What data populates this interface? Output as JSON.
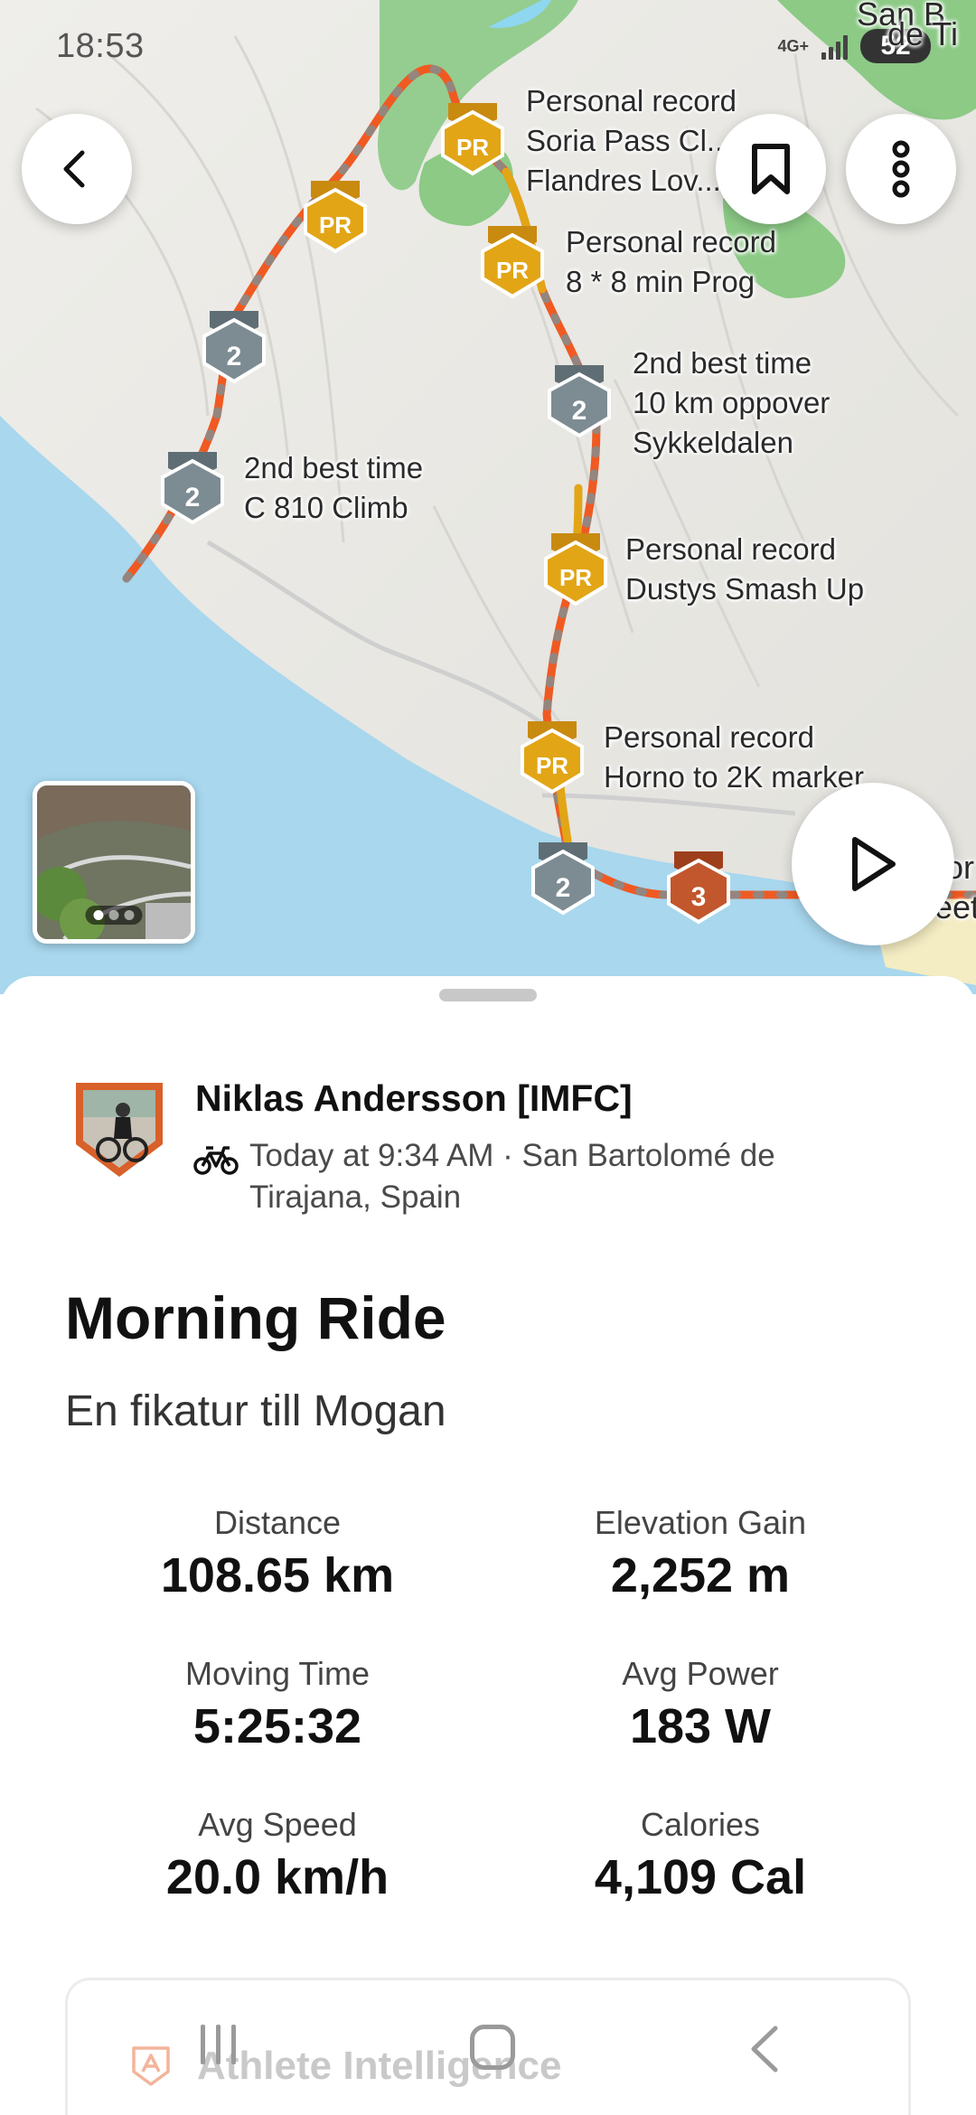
{
  "status_bar": {
    "time": "18:53",
    "network": "4G+",
    "battery": "52"
  },
  "map": {
    "place_label_fragments": [
      "San B",
      "de Ti",
      "or",
      "eet"
    ],
    "segments": [
      {
        "status": "Personal record",
        "name": "Soria Pass Cl... ***",
        "name2": "Flandres Lov...",
        "medal": "PR"
      },
      {
        "status": "Personal record",
        "name": "8 * 8 min Prog",
        "medal": "PR"
      },
      {
        "status": "2nd best time",
        "name": "10 km oppover",
        "name2": "Sykkeldalen",
        "medal": "2"
      },
      {
        "status": "2nd best time",
        "name": "C 810 Climb",
        "medal": "2"
      },
      {
        "status": "Personal record",
        "name": "Dustys Smash Up",
        "medal": "PR"
      },
      {
        "status": "Personal record",
        "name": "Horno to 2K marker",
        "medal": "PR"
      }
    ],
    "medals_unlabeled": [
      "PR",
      "2",
      "2",
      "3"
    ],
    "photo_count": 3,
    "active_photo": 1
  },
  "activity": {
    "athlete_name": "Niklas Andersson [IMFC]",
    "meta": "Today at 9:34 AM · San Bartolomé de Tirajana, Spain",
    "title": "Morning Ride",
    "description": "En fikatur till Mogan",
    "stats": [
      {
        "label": "Distance",
        "value": "108.65 km"
      },
      {
        "label": "Elevation Gain",
        "value": "2,252 m"
      },
      {
        "label": "Moving Time",
        "value": "5:25:32"
      },
      {
        "label": "Avg Power",
        "value": "183 W"
      },
      {
        "label": "Avg Speed",
        "value": "20.0 km/h"
      },
      {
        "label": "Calories",
        "value": "4,109 Cal"
      }
    ],
    "athlete_intelligence": "Athlete Intelligence"
  },
  "colors": {
    "route": "#f05a22",
    "pr_gold": "#e2a516",
    "silver": "#7d8c92",
    "bronze": "#c2562d",
    "sea": "#a8d7ee",
    "green": "#7cc37c"
  }
}
